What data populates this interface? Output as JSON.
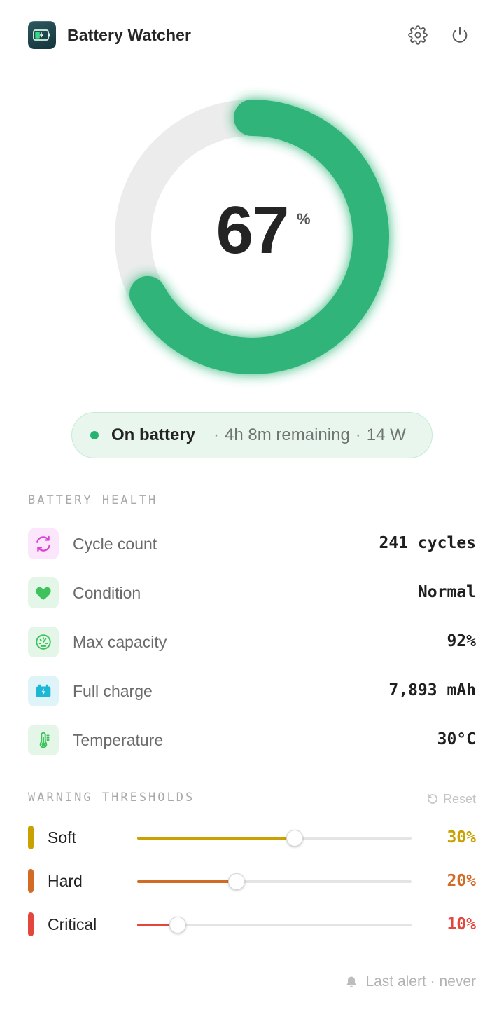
{
  "app": {
    "title": "Battery Watcher",
    "icon": "battery-charging-icon",
    "accent": "#27b273"
  },
  "header": {
    "settings_icon": "gear-icon",
    "power_icon": "power-icon"
  },
  "gauge": {
    "percent": 67,
    "percent_text": "67",
    "percent_sign": "%",
    "fill_color": "#27b273",
    "track_color": "#ececec"
  },
  "status": {
    "state": "On battery",
    "separator": "·",
    "remaining": "4h 8m remaining",
    "power": "14 W"
  },
  "health": {
    "label": "BATTERY HEALTH",
    "items": [
      {
        "icon": "cycle-icon",
        "label": "Cycle count",
        "value": "241 cycles",
        "icon_bg": "#fbe6fb",
        "icon_color": "#d940d9"
      },
      {
        "icon": "heart-icon",
        "label": "Condition",
        "value": "Normal",
        "icon_bg": "#e3f6e8",
        "icon_color": "#3ec25c"
      },
      {
        "icon": "gauge-icon",
        "label": "Max capacity",
        "value": "92%",
        "icon_bg": "#e3f6e8",
        "icon_color": "#3ec25c"
      },
      {
        "icon": "battery-bolt-icon",
        "label": "Full charge",
        "value": "7,893 mAh",
        "icon_bg": "#dff4f8",
        "icon_color": "#1cb7d6"
      },
      {
        "icon": "thermometer-icon",
        "label": "Temperature",
        "value": "30°C",
        "icon_bg": "#e3f6e8",
        "icon_color": "#3ec25c"
      }
    ]
  },
  "thresholds": {
    "label": "WARNING THRESHOLDS",
    "reset_label": "Reset",
    "reset_icon": "reset-icon",
    "items": [
      {
        "label": "Soft",
        "value": "30%",
        "level": 0.575,
        "color": "#c9a100"
      },
      {
        "label": "Hard",
        "value": "20%",
        "level": 0.362,
        "color": "#d26b24"
      },
      {
        "label": "Critical",
        "value": "10%",
        "level": 0.148,
        "color": "#e3463d"
      }
    ]
  },
  "footer": {
    "icon": "bell-icon",
    "text": "Last alert · never"
  }
}
